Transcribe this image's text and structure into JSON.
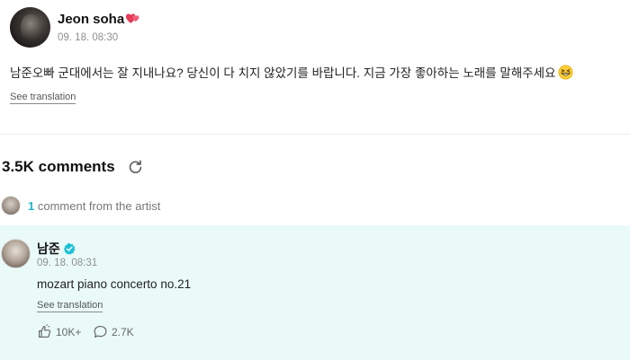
{
  "post": {
    "author": "Jeon soha",
    "date": "09. 18. 08:30",
    "body": "남준오빠 군대에서는 잘 지내나요? 당신이 다 치지 않았기를 바랍니다. 지금 가장 좋아하는 노래를 말해주세요",
    "see_translation": "See translation",
    "icons": {
      "heart": "two-hearts-icon",
      "emoji": "grinning-squint-face-icon"
    }
  },
  "comments": {
    "count_label": "3.5K comments",
    "refresh_icon": "refresh-icon",
    "artist_notice": {
      "count": "1",
      "text": "comment from the artist"
    }
  },
  "artist_comment": {
    "name": "남준",
    "date": "09. 18. 08:31",
    "text": "mozart piano concerto no.21",
    "see_translation": "See translation",
    "likes": "10K+",
    "replies": "2.7K",
    "colors": {
      "background": "#e9faf8",
      "accent": "#1fb5c8",
      "verified": "#1ec2d8"
    }
  }
}
